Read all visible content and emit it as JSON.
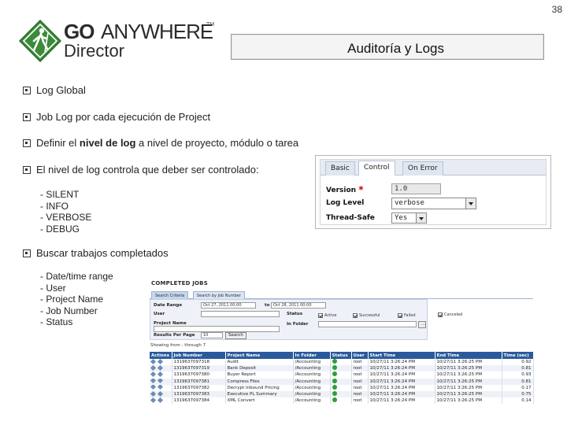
{
  "slide_number": "38",
  "logo": {
    "go": "GO",
    "anywhere": "ANYWHERE",
    "tm": "TM",
    "director": "Director",
    "brand_color": "#3d8a3a"
  },
  "title": "Auditoría y Logs",
  "bullets": {
    "b1": "Log Global",
    "b2": "Job Log por cada ejecución de Project",
    "b3_pre": "Definir el ",
    "b3_bold": "nivel de log",
    "b3_post": " a nivel de proyecto, módulo o tarea",
    "b4": "El nivel de log controla que deber ser controlado:",
    "b5": "Buscar trabajos completados"
  },
  "log_levels": [
    "- SILENT",
    "- INFO",
    "- VERBOSE",
    "- DEBUG"
  ],
  "search_fields": [
    "- Date/time range",
    "- User",
    "- Project Name",
    "- Job Number",
    "- Status"
  ],
  "control_panel": {
    "tabs": [
      "Basic",
      "Control",
      "On Error"
    ],
    "active_tab": "Control",
    "version_label": "Version",
    "required_mark": "*",
    "version_value": "1.0",
    "log_level_label": "Log Level",
    "log_level_value": "verbose",
    "thread_safe_label": "Thread-Safe",
    "thread_safe_value": "Yes"
  },
  "completed_jobs": {
    "title": "COMPLETED JOBS",
    "tabs": [
      "Search Criteria",
      "Search by Job Number"
    ],
    "date_range_label": "Date Range",
    "date_from": "Oct 27, 2011 00:00",
    "to_label": "to",
    "date_to": "Oct 28, 2011 00:00",
    "user_label": "User",
    "status_label": "Status",
    "status_options": [
      "Active",
      "Successful",
      "Failed",
      "Canceled"
    ],
    "project_name_label": "Project Name",
    "in_folder_label": "In Folder",
    "results_per_page_label": "Results Per Page",
    "results_per_page_value": "10",
    "search_button": "Search",
    "showing_text": "Showing from : through 7",
    "columns": [
      "Actions",
      "Job Number",
      "Project Name",
      "In Folder",
      "Status",
      "User",
      "Start Time",
      "End Time",
      "Time (sec)"
    ],
    "rows": [
      [
        "1319637097318",
        "Audit",
        "/Accounting",
        "root",
        "10/27/11 3:26:24 PM",
        "10/27/11 3:26:25 PM",
        "0.92"
      ],
      [
        "1319637097319",
        "Bank Deposit",
        "/Accounting",
        "root",
        "10/27/11 3:26:24 PM",
        "10/27/11 3:26:25 PM",
        "0.81"
      ],
      [
        "1319637097380",
        "Buyer Report",
        "/Accounting",
        "root",
        "10/27/11 3:26:24 PM",
        "10/27/11 3:26:25 PM",
        "0.93"
      ],
      [
        "1319637097381",
        "Compress Files",
        "/Accounting",
        "root",
        "10/27/11 3:26:24 PM",
        "10/27/11 3:26:25 PM",
        "0.81"
      ],
      [
        "1319637097382",
        "Decrypt Inbound Pricing",
        "/Accounting",
        "root",
        "10/27/11 3:26:24 PM",
        "10/27/11 3:26:25 PM",
        "0.17"
      ],
      [
        "1319637097383",
        "Executive PL Summary",
        "/Accounting",
        "root",
        "10/27/11 3:26:24 PM",
        "10/27/11 3:26:25 PM",
        "0.75"
      ],
      [
        "1319637097384",
        "XML Convert",
        "/Accounting",
        "root",
        "10/27/11 3:26:24 PM",
        "10/27/11 3:26:25 PM",
        "0.14"
      ]
    ]
  }
}
